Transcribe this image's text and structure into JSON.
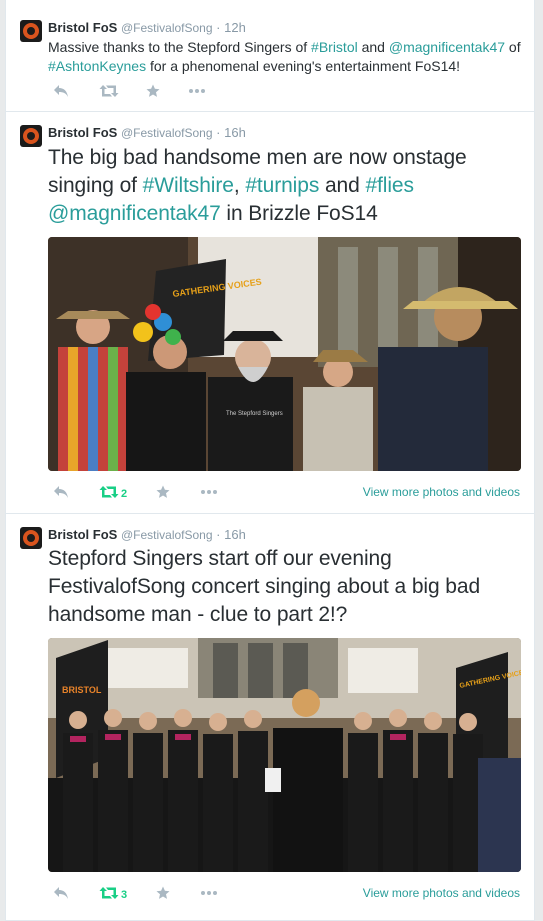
{
  "tweets": [
    {
      "fullname": "Bristol FoS",
      "username": "@FestivalofSong",
      "dot": "·",
      "time": "12h",
      "segments": [
        {
          "t": "Massive thanks to the Stepford Singers of ",
          "link": false
        },
        {
          "t": "#Bristol",
          "link": true
        },
        {
          "t": " and ",
          "link": false
        },
        {
          "t": "@magnificentak47",
          "link": true
        },
        {
          "t": " of ",
          "link": false
        },
        {
          "t": "#AshtonKeynes",
          "link": true
        },
        {
          "t": " for a phenomenal evening's entertainment FoS14!",
          "link": false
        }
      ],
      "retweet_count": "",
      "media_link": ""
    },
    {
      "fullname": "Bristol FoS",
      "username": "@FestivalofSong",
      "dot": "·",
      "time": "16h",
      "segments": [
        {
          "t": "The big bad handsome men are now onstage singing of ",
          "link": false
        },
        {
          "t": "#Wiltshire",
          "link": true
        },
        {
          "t": ", ",
          "link": false
        },
        {
          "t": "#turnips",
          "link": true
        },
        {
          "t": " and ",
          "link": false
        },
        {
          "t": "#flies",
          "link": true
        },
        {
          "t": " ",
          "link": false
        },
        {
          "t": "@magnificentak47",
          "link": true
        },
        {
          "t": " in Brizzle FoS14",
          "link": false
        }
      ],
      "photo_banner_text": "GATHERING VOICES",
      "shirt_text": "The Stepford Singers",
      "retweet_count": "2",
      "media_link": "View more photos and videos"
    },
    {
      "fullname": "Bristol FoS",
      "username": "@FestivalofSong",
      "dot": "·",
      "time": "16h",
      "segments": [
        {
          "t": "Stepford Singers start off our evening FestivalofSong concert singing about a big bad handsome man - clue to part 2!?",
          "link": false
        }
      ],
      "photo_banner_left": "BRISTOL",
      "photo_banner_right": "GATHERING VOICES",
      "retweet_count": "3",
      "media_link": "View more photos and videos"
    }
  ],
  "colors": {
    "link": "#2a9d9a",
    "retweet_active": "#19cf86",
    "muted": "#8899a6",
    "icon": "#aab8c2"
  },
  "icons": [
    "reply-icon",
    "retweet-icon",
    "favorite-icon",
    "more-icon"
  ]
}
